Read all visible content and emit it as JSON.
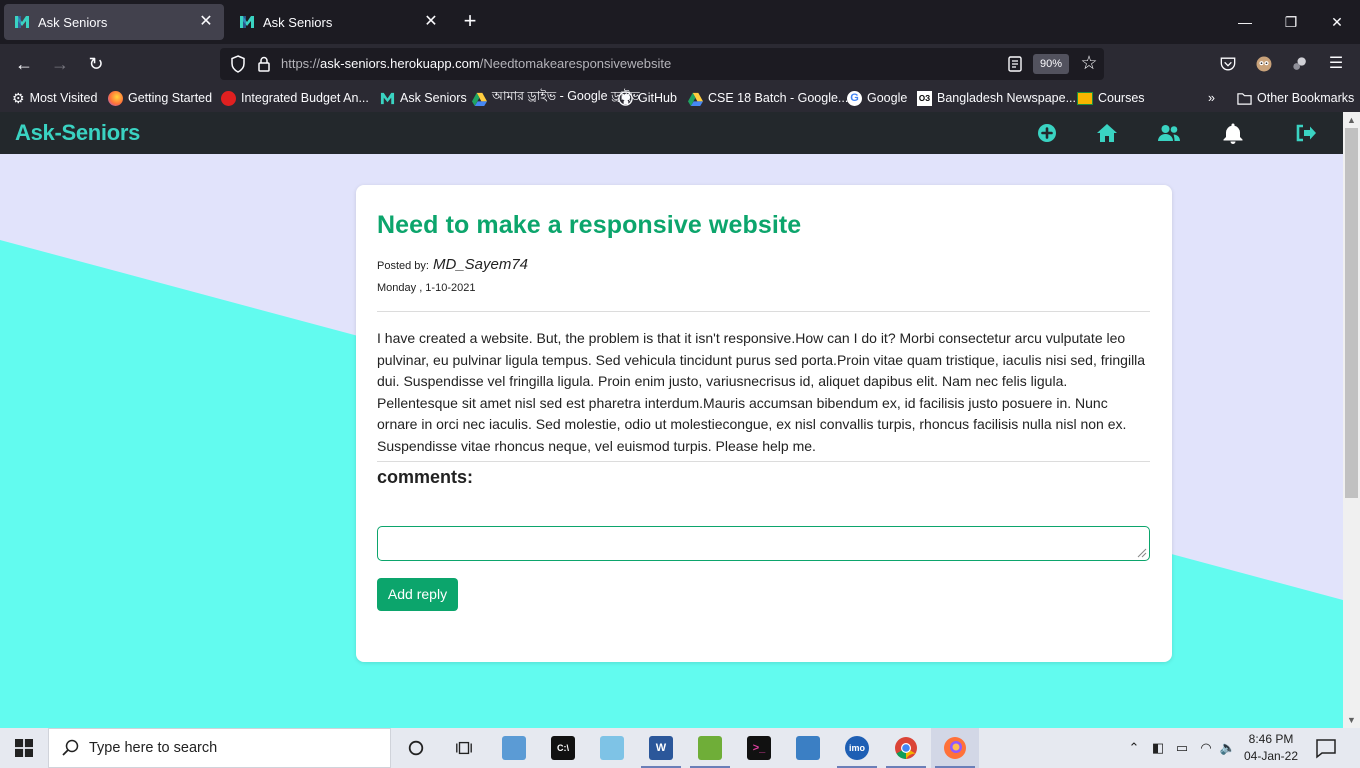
{
  "browser": {
    "tabs": [
      {
        "title": "Ask Seniors",
        "active": true
      },
      {
        "title": "Ask Seniors",
        "active": false
      }
    ],
    "url_prefix": "https://",
    "url_host": "ask-seniors.herokuapp.com",
    "url_path": "/Needtomakearesponsivewebsite",
    "zoom": "90%",
    "bookmarks": [
      {
        "label": "Most Visited",
        "icon": "gear-icon",
        "color": "#ffffff"
      },
      {
        "label": "Getting Started",
        "icon": "firefox-icon",
        "color": "#ff7139"
      },
      {
        "label": "Integrated Budget An...",
        "icon": "budget-icon",
        "color": "#e02020"
      },
      {
        "label": "Ask Seniors",
        "icon": "askseniors-icon",
        "color": "#3ad3c2"
      },
      {
        "label": "আমার ড্রাইভ - Google ড্রাইভ",
        "icon": "drive-icon",
        "color": "#1fa463"
      },
      {
        "label": "GitHub",
        "icon": "github-icon",
        "color": "#ffffff"
      },
      {
        "label": "CSE 18 Batch - Google...",
        "icon": "drive-icon",
        "color": "#1fa463"
      },
      {
        "label": "Google",
        "icon": "google-icon",
        "color": "#4285f4"
      },
      {
        "label": "Bangladesh Newspape...",
        "icon": "newspaper-icon",
        "color": "#ffffff"
      },
      {
        "label": "Courses",
        "icon": "classroom-icon",
        "color": "#f7b500"
      }
    ],
    "other_bookmarks": "Other Bookmarks"
  },
  "app": {
    "brand": "Ask-Seniors",
    "nav_icons": [
      "add-icon",
      "home-icon",
      "users-icon",
      "bell-icon",
      "logout-icon"
    ],
    "accent": "#0ca56c",
    "brand_color": "#3ad3c2"
  },
  "question": {
    "title": "Need to make a responsive website",
    "posted_by_label": "Posted by:",
    "author": "MD_Sayem74",
    "date": "Monday , 1-10-2021",
    "body": "I have created a website. But, the problem is that it isn't responsive.How can I do it? Morbi consectetur arcu vulputate leo pulvinar, eu pulvinar ligula tempus. Sed vehicula tincidunt purus sed porta.Proin vitae quam tristique, iaculis nisi sed, fringilla dui. Suspendisse vel fringilla ligula. Proin enim justo, variusnecrisus id, aliquet dapibus elit. Nam nec felis ligula. Pellentesque sit amet nisl sed est pharetra interdum.Mauris accumsan bibendum ex, id facilisis justo posuere in. Nunc ornare in orci nec iaculis. Sed molestie, odio ut molestiecongue, ex nisl convallis turpis, rhoncus facilisis nulla nisl non ex. Suspendisse vitae rhoncus neque, vel euismod turpis. Please help me.",
    "comments_label": "comments:",
    "reply_value": "",
    "add_reply_label": "Add reply"
  },
  "taskbar": {
    "search_placeholder": "Type here to search",
    "time": "8:46 PM",
    "date": "04-Jan-22"
  }
}
